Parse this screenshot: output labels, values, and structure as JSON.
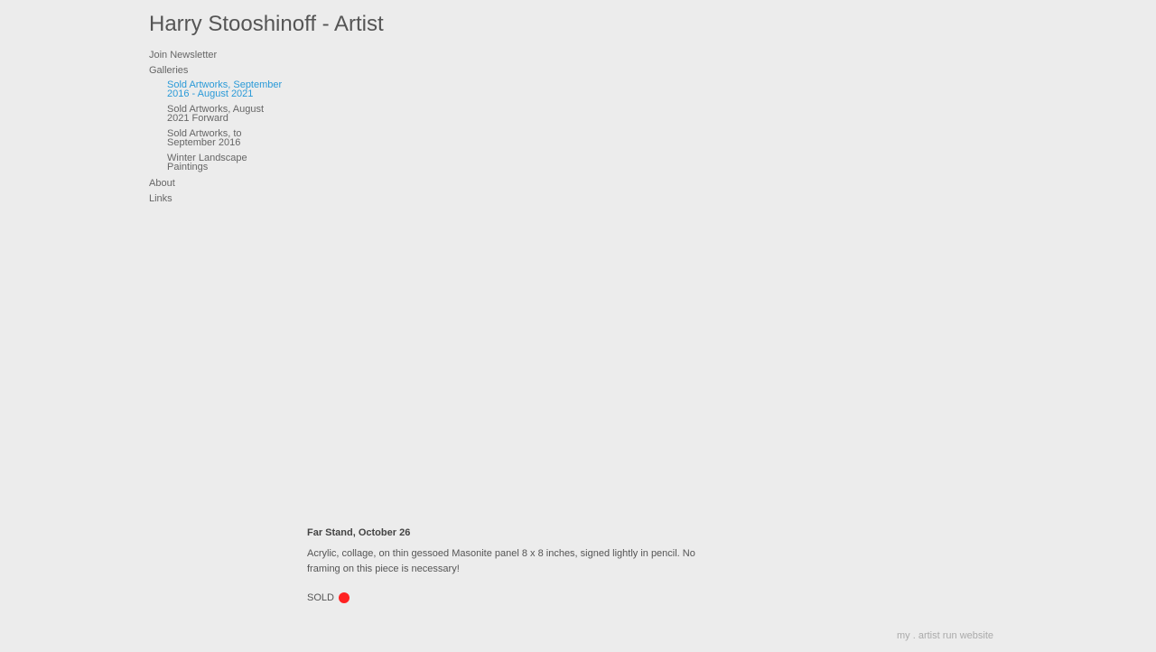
{
  "site": {
    "title": "Harry Stooshinoff - Artist"
  },
  "nav": {
    "join_newsletter": "Join Newsletter",
    "galleries": "Galleries",
    "galleries_items": [
      {
        "label_line1": "Sold Artworks, September",
        "label_line2": "2016 - August 2021",
        "active": true
      },
      {
        "label_line1": "Sold Artworks, August",
        "label_line2": "2021 Forward",
        "active": false
      },
      {
        "label_line1": "Sold Artworks, to",
        "label_line2": "September 2016",
        "active": false
      },
      {
        "label_line1": "Winter Landscape",
        "label_line2": "Paintings",
        "active": false
      }
    ],
    "about": "About",
    "links": "Links"
  },
  "artwork": {
    "title": "Far Stand, October 26",
    "description": "Acrylic, collage, on thin gessoed Masonite panel 8 x 8 inches, signed lightly in pencil. No framing on this piece is necessary!",
    "status": "SOLD",
    "status_color": "#ff2222"
  },
  "footer": {
    "link_text": "my . artist run website"
  },
  "colors": {
    "background": "#ececec",
    "active_link": "#2a9ad8",
    "text": "#555555"
  }
}
